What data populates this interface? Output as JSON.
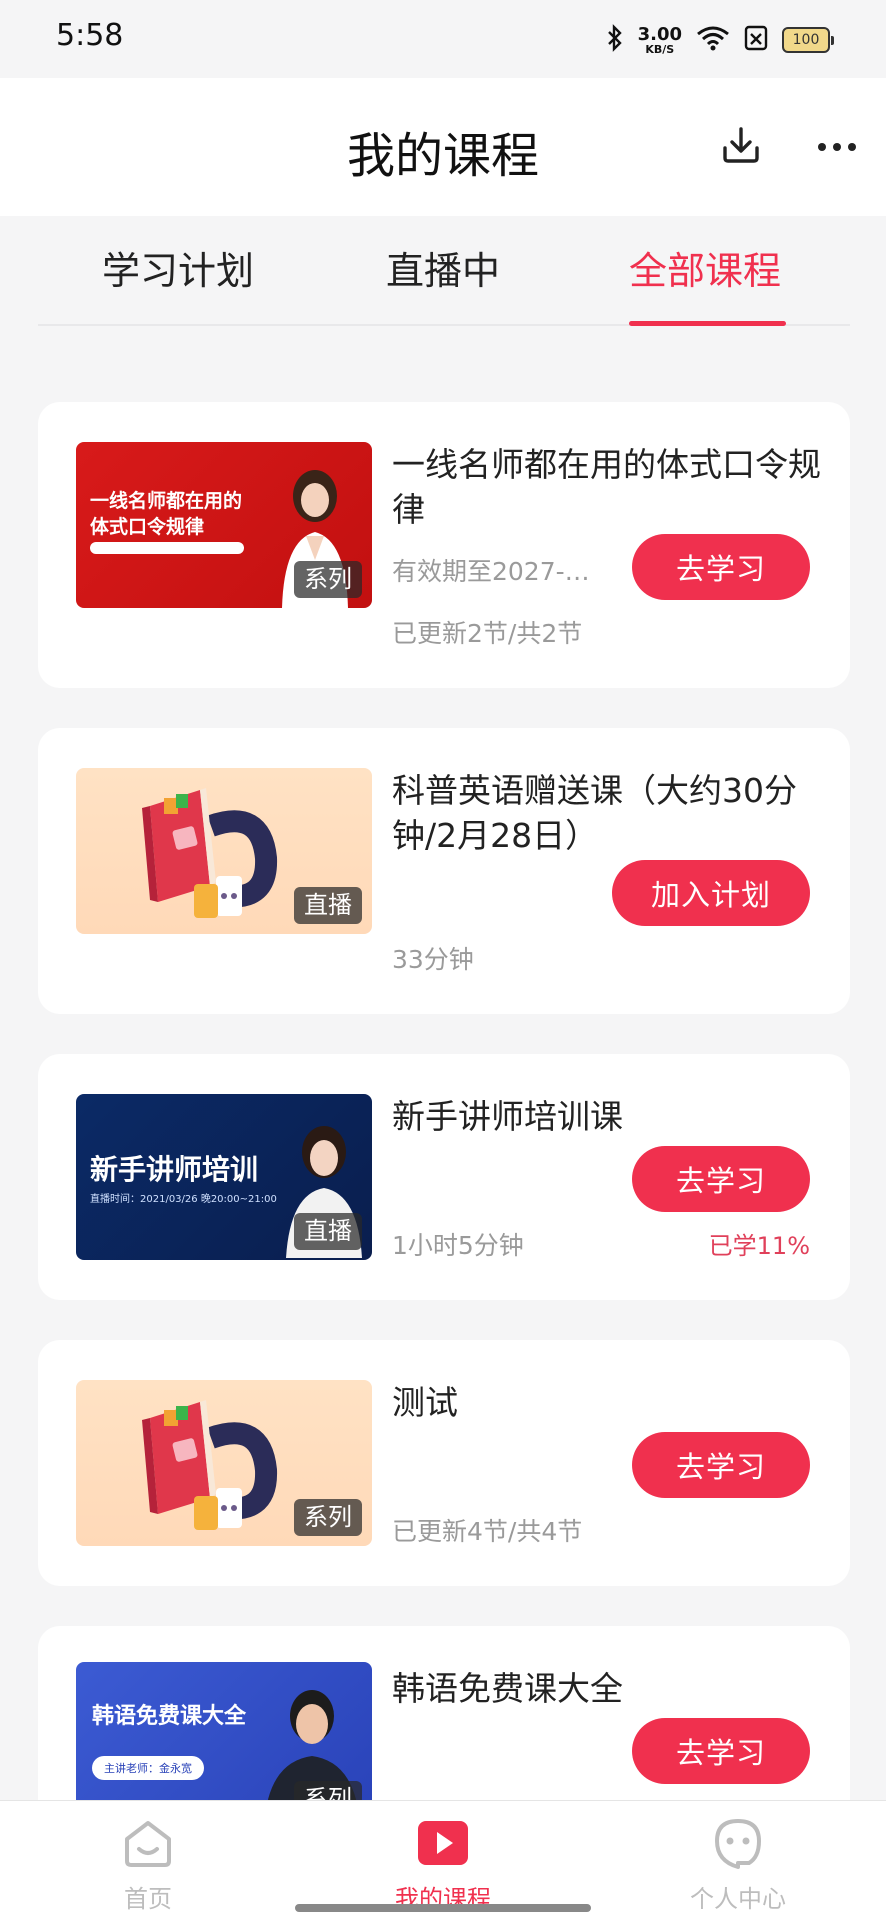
{
  "status_bar": {
    "time": "5:58",
    "net_speed_value": "3.00",
    "net_speed_unit": "KB/S",
    "battery": "100"
  },
  "header": {
    "title": "我的课程",
    "download_icon": "download-icon",
    "more_icon": "more-icon"
  },
  "tabs": [
    {
      "label": "学习计划",
      "active": false
    },
    {
      "label": "直播中",
      "active": false
    },
    {
      "label": "全部课程",
      "active": true
    }
  ],
  "courses": [
    {
      "title": "一线名师都在用的体式口令规律",
      "meta1": "有效期至2027-…",
      "meta2": "已更新2节/共2节",
      "tag": "系列",
      "button": "去学习",
      "thumb_text_1": "一线名师都在用的",
      "thumb_text_2": "体式口令规律"
    },
    {
      "title": "科普英语赠送课（大约30分钟/2月28日）",
      "meta1": "33分钟",
      "tag": "直播",
      "button": "加入计划"
    },
    {
      "title": "新手讲师培训课",
      "meta1": "1小时5分钟",
      "progress": "已学11%",
      "tag": "直播",
      "button": "去学习",
      "thumb_title": "新手讲师培训",
      "thumb_sub": "直播时间：2021/03/26 晚20:00~21:00"
    },
    {
      "title": "测试",
      "meta1": "已更新4节/共4节",
      "tag": "系列",
      "button": "去学习"
    },
    {
      "title": "韩语免费课大全",
      "tag": "系列",
      "button": "去学习",
      "thumb_title": "韩语免费课大全",
      "thumb_sub": "主讲老师：金永宽"
    }
  ],
  "bottom_nav": [
    {
      "label": "首页",
      "icon": "home-icon",
      "active": false
    },
    {
      "label": "我的课程",
      "icon": "play-icon",
      "active": true
    },
    {
      "label": "个人中心",
      "icon": "profile-icon",
      "active": false
    }
  ],
  "colors": {
    "accent": "#f0304e",
    "background": "#f5f5f6"
  }
}
